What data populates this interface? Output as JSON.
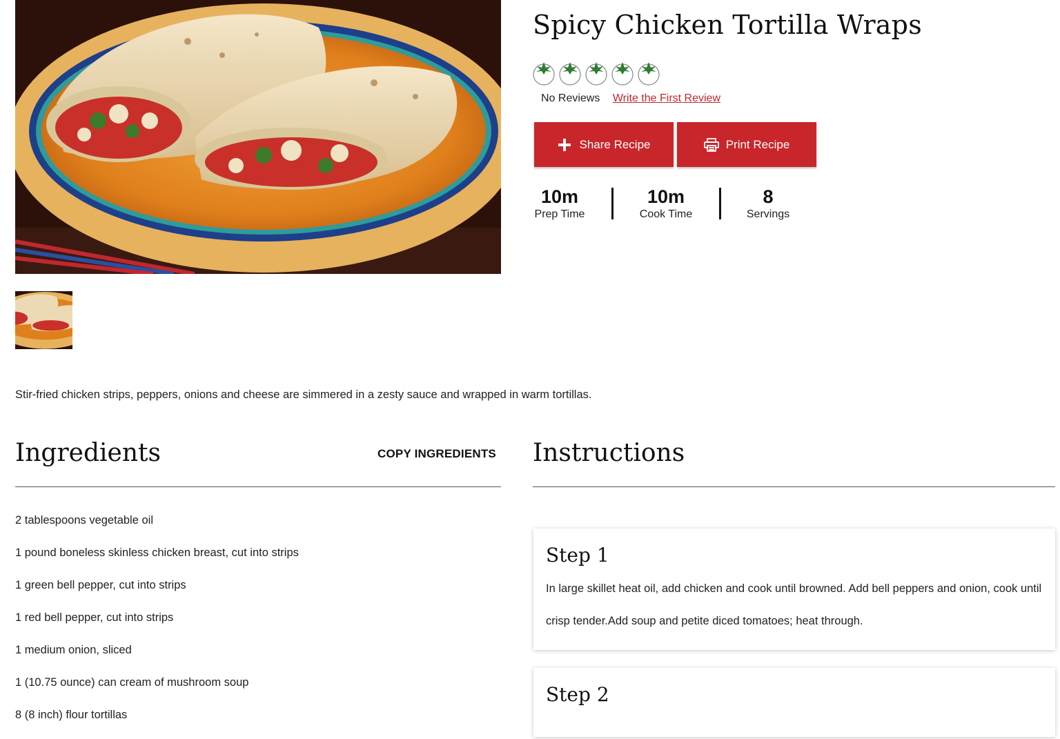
{
  "recipe": {
    "title": "Spicy Chicken Tortilla Wraps",
    "rating": {
      "value": 0,
      "max": 5,
      "icon": "tomato-icon"
    },
    "no_reviews": "No Reviews",
    "write_review": "Write the First Review",
    "description": "Stir-fried chicken strips, peppers, onions and cheese are simmered in a zesty sauce and wrapped in warm tortillas."
  },
  "actions": {
    "share_label": "Share Recipe",
    "share_icon": "plus-icon",
    "print_label": "Print Recipe",
    "print_icon": "printer-icon"
  },
  "stats": {
    "prep": {
      "value": "10m",
      "label": "Prep Time"
    },
    "cook": {
      "value": "10m",
      "label": "Cook Time"
    },
    "servings": {
      "value": "8",
      "label": "Servings"
    }
  },
  "ingredients": {
    "heading": "Ingredients",
    "copy_label": "COPY INGREDIENTS",
    "items": [
      "2 tablespoons vegetable oil",
      "1 pound boneless skinless chicken breast, cut into strips",
      "1 green bell pepper, cut into strips",
      "1 red bell pepper, cut into strips",
      "1 medium onion, sliced",
      "1 (10.75 ounce) can cream of mushroom soup",
      "8 (8 inch) flour tortillas"
    ]
  },
  "instructions": {
    "heading": "Instructions",
    "steps": [
      {
        "title": "Step 1",
        "text": "In large skillet heat oil, add chicken and cook until browned. Add bell peppers and onion, cook until crisp tender.Add soup and petite diced tomatoes; heat through."
      },
      {
        "title": "Step 2",
        "text": ""
      }
    ]
  },
  "colors": {
    "accent": "#c8262b",
    "link": "#c0282d",
    "tomato_leaf": "#2e7d32"
  }
}
